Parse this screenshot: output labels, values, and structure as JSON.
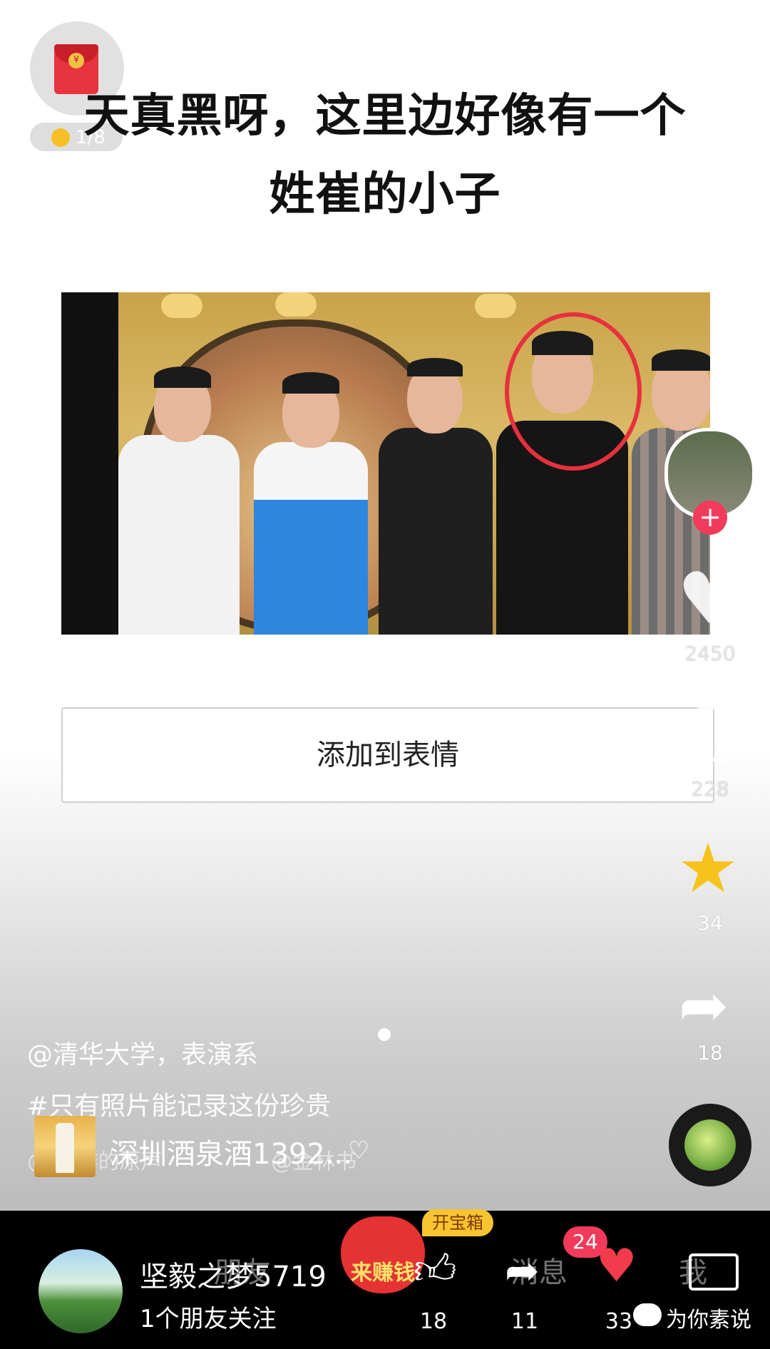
{
  "red_packet": {
    "seal_char": "¥",
    "progress": "1/8"
  },
  "headline": "天真黑呀，这里边好像有一个\n姓崔的小子",
  "photo": {
    "subject": "group photo of five men, one circled in red"
  },
  "add_button": {
    "label": "添加到表情"
  },
  "rail": {
    "like_count": "2450",
    "comment_count": "228",
    "favorite_count": "34",
    "share_count": "18"
  },
  "overlay": {
    "mention": "@清华大学，表演系",
    "hashtag": "#只有照片能记录这份珍贵",
    "music_ghost": "@ 创作的原声",
    "music_author_ghost": "@金林书"
  },
  "product": {
    "name": "深圳酒泉酒1392..."
  },
  "bottom_bar": {
    "username": "坚毅之梦5719",
    "follow_info": "1个朋友关注",
    "tab_friends_ghost": "朋友",
    "tab_messages_ghost": "消息",
    "tab_me_ghost": "我",
    "earn_label": "来赚钱",
    "chest_badge": "开宝箱",
    "message_badge": "24",
    "like_count": "18",
    "share_count": "11",
    "heart_count": "33",
    "watermark": "为你素说"
  },
  "icons": {
    "like": "thumbs-up-icon",
    "share": "share-icon",
    "heart": "heart-icon",
    "comment": "comment-icon",
    "star": "star-icon"
  },
  "colors": {
    "accent_red": "#f23b5b",
    "gold": "#f6c31c",
    "circle_red": "#e8303d"
  }
}
